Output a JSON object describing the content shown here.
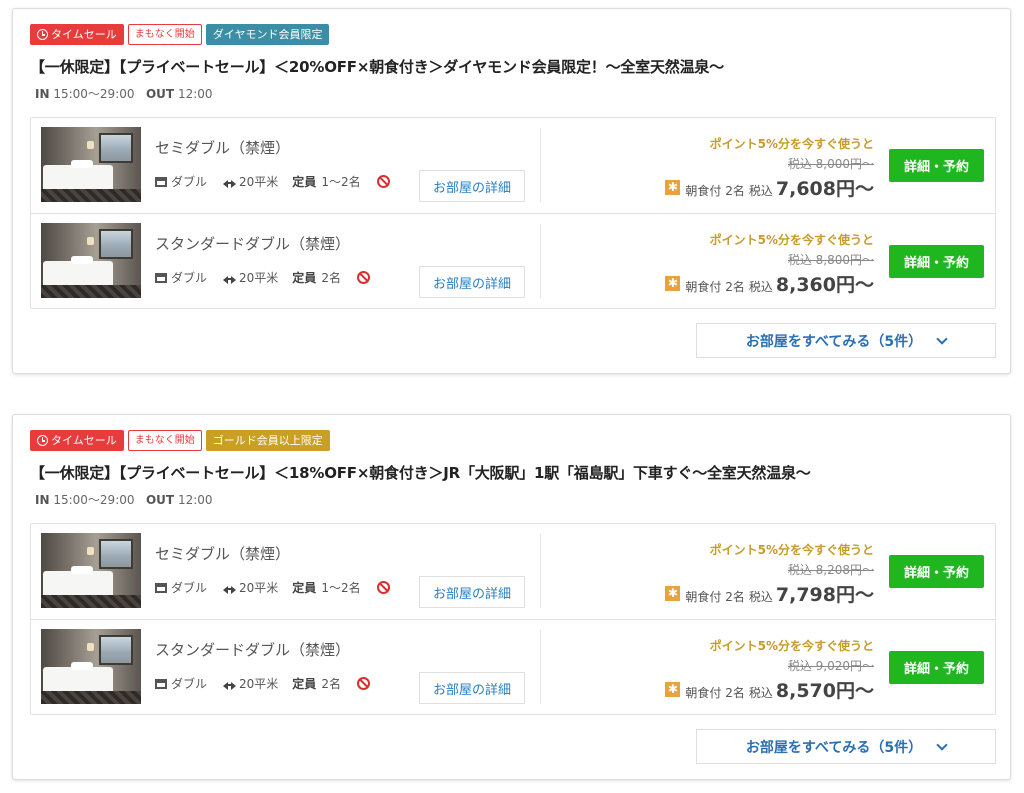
{
  "plans": [
    {
      "badges": {
        "timesale": "タイムセール",
        "soon": "まもなく開始",
        "member": "ダイヤモンド会員限定",
        "member_color": "#3b8ea3"
      },
      "title": "【一休限定】【プライベートセール】＜20%OFF×朝食付き＞ダイヤモンド会員限定！～全室天然温泉～",
      "checkin_label": "IN",
      "checkin_time": "15:00～29:00",
      "checkout_label": "OUT",
      "checkout_time": "12:00",
      "rooms": [
        {
          "name": "セミダブル（禁煙）",
          "bed": "ダブル",
          "area": "20平米",
          "capacity_label": "定員",
          "capacity": "1～2名",
          "detail_label": "お部屋の詳細",
          "promo": "ポイント5%分を今すぐ使うと",
          "old_price": "税込 8,000円～",
          "meal": "朝食付 2名",
          "tax": "税込",
          "price": "7,608円～",
          "reserve_label": "詳細・予約"
        },
        {
          "name": "スタンダードダブル（禁煙）",
          "bed": "ダブル",
          "area": "20平米",
          "capacity_label": "定員",
          "capacity": "2名",
          "detail_label": "お部屋の詳細",
          "promo": "ポイント5%分を今すぐ使うと",
          "old_price": "税込 8,800円～",
          "meal": "朝食付 2名",
          "tax": "税込",
          "price": "8,360円～",
          "reserve_label": "詳細・予約"
        }
      ],
      "see_all_label": "お部屋をすべてみる（5件）"
    },
    {
      "badges": {
        "timesale": "タイムセール",
        "soon": "まもなく開始",
        "member": "ゴールド会員以上限定",
        "member_color": "#c9a022"
      },
      "title": "【一休限定】【プライベートセール】＜18%OFF×朝食付き＞JR「大阪駅」1駅「福島駅」下車すぐ～全室天然温泉～",
      "checkin_label": "IN",
      "checkin_time": "15:00～29:00",
      "checkout_label": "OUT",
      "checkout_time": "12:00",
      "rooms": [
        {
          "name": "セミダブル（禁煙）",
          "bed": "ダブル",
          "area": "20平米",
          "capacity_label": "定員",
          "capacity": "1～2名",
          "detail_label": "お部屋の詳細",
          "promo": "ポイント5%分を今すぐ使うと",
          "old_price": "税込 8,208円～",
          "meal": "朝食付 2名",
          "tax": "税込",
          "price": "7,798円～",
          "reserve_label": "詳細・予約"
        },
        {
          "name": "スタンダードダブル（禁煙）",
          "bed": "ダブル",
          "area": "20平米",
          "capacity_label": "定員",
          "capacity": "2名",
          "detail_label": "お部屋の詳細",
          "promo": "ポイント5%分を今すぐ使うと",
          "old_price": "税込 9,020円～",
          "meal": "朝食付 2名",
          "tax": "税込",
          "price": "8,570円～",
          "reserve_label": "詳細・予約"
        }
      ],
      "see_all_label": "お部屋をすべてみる（5件）"
    }
  ],
  "icons": {
    "meal": "sun-icon",
    "bed": "bed-icon",
    "area": "area-arrows-icon",
    "nosmoke": "no-smoking-icon",
    "clock": "clock-icon",
    "chevron": "chevron-down-icon"
  }
}
